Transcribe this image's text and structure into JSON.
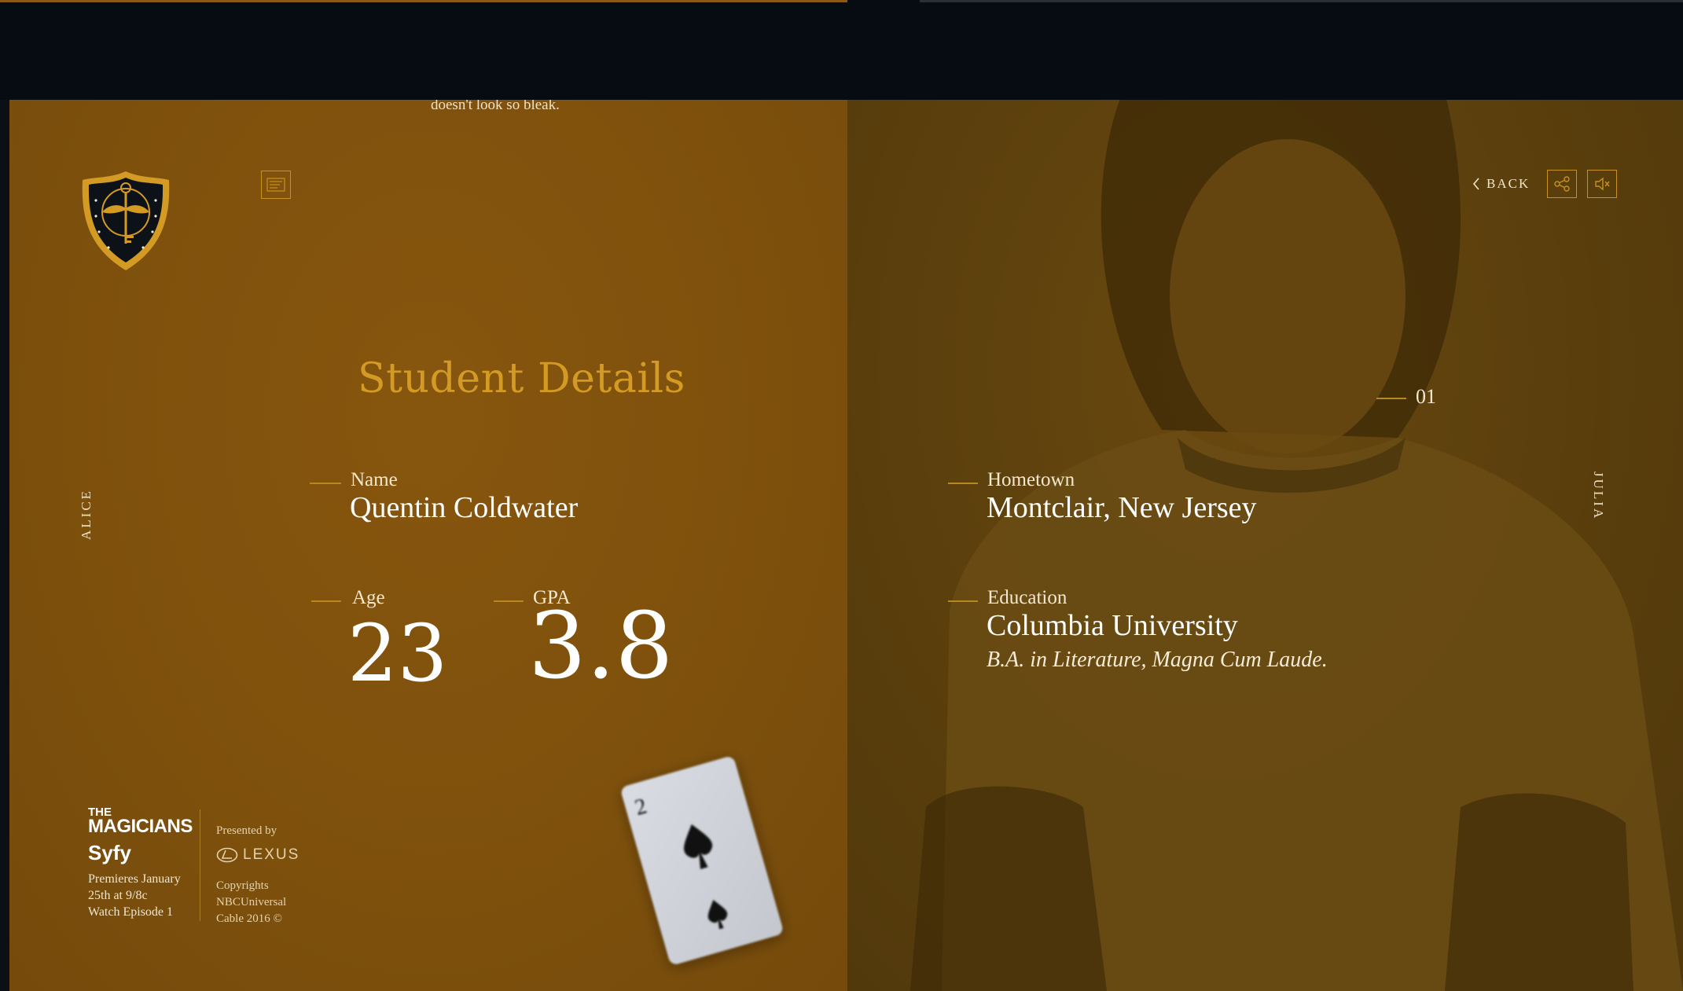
{
  "overflow_text": "doesn't look so bleak.",
  "header": {
    "back_label": "BACK"
  },
  "nav": {
    "prev_character": "ALICE",
    "next_character": "JULIA",
    "page_number": "01"
  },
  "student": {
    "section_title": "Student Details",
    "name_label": "Name",
    "name_value": "Quentin Coldwater",
    "age_label": "Age",
    "age_value": "23",
    "gpa_label": "GPA",
    "gpa_value": "3.8",
    "hometown_label": "Hometown",
    "hometown_value": "Montclair, New Jersey",
    "education_label": "Education",
    "education_value": "Columbia University",
    "education_detail": "B.A. in Literature, Magna Cum Laude."
  },
  "footer": {
    "show_title_line1": "THE",
    "show_title_line2": "MAGICIANS",
    "network": "Syfy",
    "premiere_line1": "Premieres January",
    "premiere_line2": "25th at 9/8c",
    "premiere_line3": "Watch Episode 1",
    "presented_by": "Presented by",
    "sponsor": "LEXUS",
    "copyright_line1": "Copyrights",
    "copyright_line2": "NBCUniversal",
    "copyright_line3": "Cable 2016 ©"
  },
  "colors": {
    "panel_gold": "#7d500c",
    "accent_gold": "#d39a24",
    "dark": "#060c12"
  },
  "icons": {
    "crest": "shield-crest-icon",
    "menu": "menu-icon",
    "back": "chevron-left-icon",
    "share": "share-icon",
    "mute": "mute-icon"
  }
}
